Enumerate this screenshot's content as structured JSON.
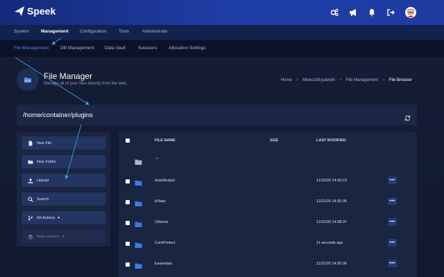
{
  "app": {
    "brand": "Speek"
  },
  "topbar": {
    "icons": [
      "cogs-icon",
      "megaphone-icon",
      "bell-icon",
      "logout-icon"
    ],
    "accent": "#1f3ea8"
  },
  "main_nav": {
    "items": [
      {
        "label": "System"
      },
      {
        "label": "Management",
        "active": true
      },
      {
        "label": "Configuration"
      },
      {
        "label": "Tools"
      },
      {
        "label": "Administrate"
      }
    ]
  },
  "sub_nav": {
    "items": [
      {
        "label": "File Management",
        "active": true
      },
      {
        "label": "DB Management"
      },
      {
        "label": "Data Vault"
      },
      {
        "label": "Subusers"
      },
      {
        "label": "Allocation Settings"
      }
    ]
  },
  "header": {
    "title": "File Manager",
    "subtitle": "Manage all of your files directly from the web.",
    "breadcrumb": [
      "Home",
      "Minecraft-palvelin",
      "File Management",
      "File Browser"
    ]
  },
  "path": {
    "value": "/home/container/plugins"
  },
  "actions": [
    {
      "label": "New File",
      "icon": "file-icon"
    },
    {
      "label": "New Folder",
      "icon": "folder-plus-icon"
    },
    {
      "label": "Upload",
      "icon": "upload-icon"
    },
    {
      "label": "Search",
      "icon": "search-icon"
    },
    {
      "label": "Git Actions",
      "icon": "git-branch-icon",
      "dropdown": true
    },
    {
      "label": "Make Actions",
      "icon": "layers-icon",
      "dropdown": true,
      "disabled": true
    }
  ],
  "table": {
    "columns": {
      "name": "FILE NAME",
      "size": "SIZE",
      "modified": "LAST MODIFIED"
    },
    "parent": "←",
    "rows": [
      {
        "name": "AutoRestart",
        "size": "",
        "modified": "11/22/20 14:30:23"
      },
      {
        "name": "bStats",
        "size": "",
        "modified": "11/22/20 14:30:36"
      },
      {
        "name": "Citizens",
        "size": "",
        "modified": "11/22/20 14:38:37"
      },
      {
        "name": "CoreProtect",
        "size": "",
        "modified": "11 seconds ago"
      },
      {
        "name": "Essentials",
        "size": "",
        "modified": "11/22/20 14:30:36"
      }
    ],
    "row_action": "•••"
  },
  "colors": {
    "accent_blue": "#4d8cf0",
    "folder_blue": "#3b7be8",
    "annotation": "#3aa0f0"
  }
}
